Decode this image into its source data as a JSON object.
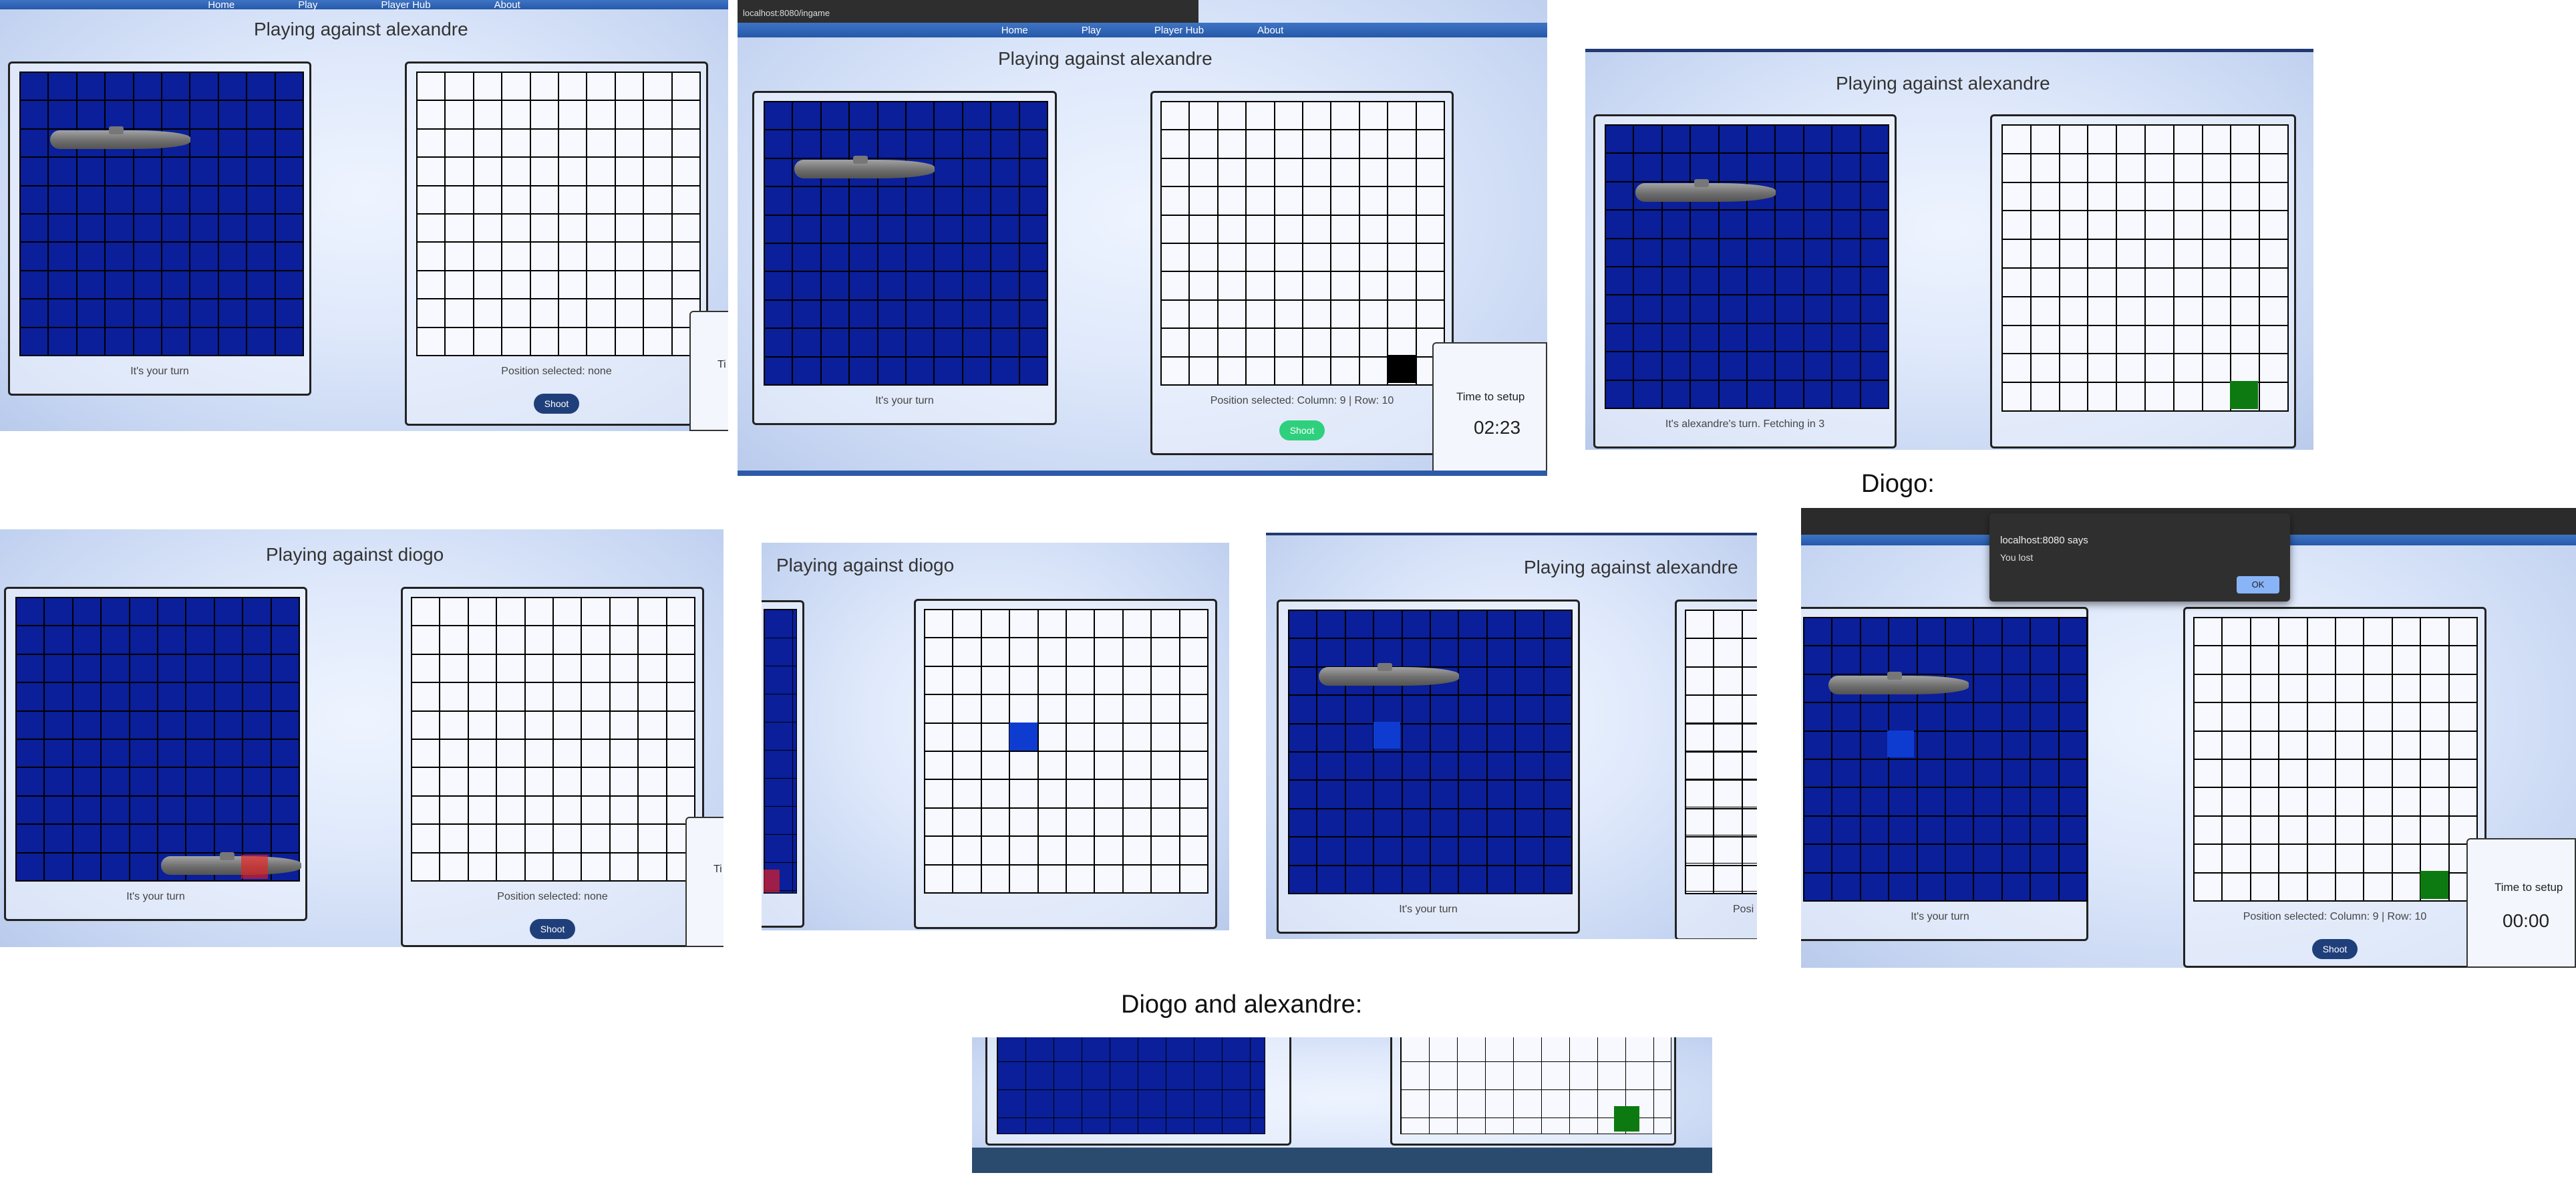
{
  "nav": {
    "items": [
      "Home",
      "Play",
      "Player Hub",
      "About"
    ]
  },
  "address_bar": {
    "url": "localhost:8080/ingame"
  },
  "panels": {
    "a1": {
      "title": "Playing against alexandre",
      "own_status": "It's your turn",
      "opp_status": "Position selected: none",
      "shoot": "Shoot",
      "timer_label_partial": "Ti"
    },
    "a2": {
      "title": "Playing against alexandre",
      "own_status": "It's your turn",
      "opp_status": "Position selected: Column: 9 | Row: 10",
      "shoot": "Shoot",
      "timer_label": "Time to setup",
      "timer_value": "02:23"
    },
    "a3": {
      "title": "Playing against alexandre",
      "own_status": "It's alexandre's turn. Fetching in 3"
    },
    "b1": {
      "title": "Playing against diogo",
      "own_status": "It's your turn",
      "opp_status": "Position selected: none",
      "shoot": "Shoot",
      "timer_label_partial": "Ti"
    },
    "b2": {
      "title": "Playing against diogo"
    },
    "b3": {
      "title": "Playing against alexandre",
      "own_status": "It's your turn",
      "opp_status_partial": "Posi"
    },
    "b4": {
      "own_status": "It's your turn",
      "opp_status": "Position selected: Column: 9 | Row: 10",
      "shoot": "Shoot",
      "timer_label": "Time to setup",
      "timer_value": "00:00"
    }
  },
  "dialog": {
    "origin": "localhost:8080 says",
    "message": "You lost",
    "ok": "OK"
  },
  "captions": {
    "diogo": "Diogo:",
    "both": "Diogo and alexandre:"
  },
  "colors": {
    "own_board": "#0a1f99",
    "shot_miss_black": "#000000",
    "hit_green": "#0c7a10",
    "selected_blue": "#0f3cd0",
    "shoot_green": "#2fd07d",
    "shoot_navy": "#1f3f7a"
  }
}
